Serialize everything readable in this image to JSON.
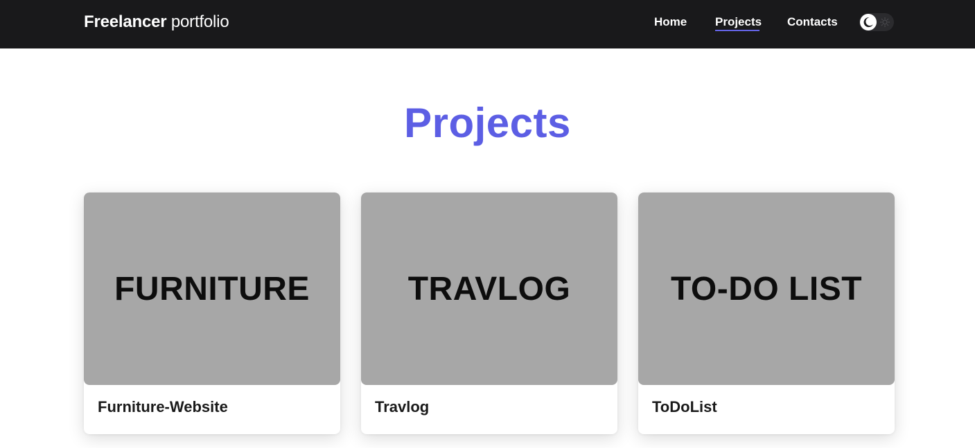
{
  "navbar": {
    "brand_strong": "Freelancer",
    "brand_light": "portfolio",
    "links": [
      {
        "label": "Home",
        "active": false
      },
      {
        "label": "Projects",
        "active": true
      },
      {
        "label": "Contacts",
        "active": false
      }
    ],
    "theme_toggle": {
      "state": "dark",
      "knob_icon": "moon-icon",
      "track_icon": "sun-icon"
    }
  },
  "page": {
    "title": "Projects"
  },
  "projects": [
    {
      "thumbnail_text": "FURNITURE",
      "title": "Furniture-Website"
    },
    {
      "thumbnail_text": "TRAVLOG",
      "title": "Travlog"
    },
    {
      "thumbnail_text": "TO-DO LIST",
      "title": "ToDoList"
    }
  ],
  "colors": {
    "navbar_bg": "#19191b",
    "accent": "#5c5ee4",
    "thumbnail_bg": "#a7a7a7",
    "page_bg": "#ffffff"
  }
}
